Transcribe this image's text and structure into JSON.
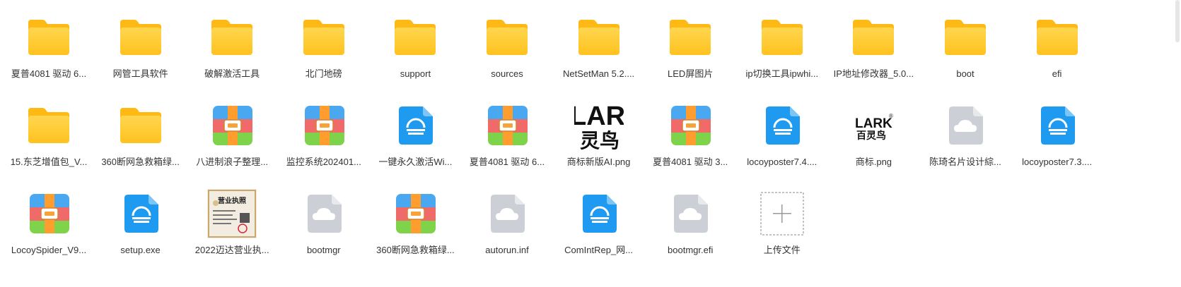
{
  "rows": [
    [
      {
        "name": "夏普4081 驱动 6...",
        "type": "folder"
      },
      {
        "name": "网管工具软件",
        "type": "folder"
      },
      {
        "name": "破解激活工具",
        "type": "folder"
      },
      {
        "name": "北门地磅",
        "type": "folder"
      },
      {
        "name": "support",
        "type": "folder"
      },
      {
        "name": "sources",
        "type": "folder"
      },
      {
        "name": "NetSetMan 5.2....",
        "type": "folder"
      },
      {
        "name": "LED屏图片",
        "type": "folder"
      },
      {
        "name": "ip切换工具ipwhi...",
        "type": "folder"
      },
      {
        "name": "IP地址修改器_5.0...",
        "type": "folder"
      },
      {
        "name": "boot",
        "type": "folder"
      },
      {
        "name": "efi",
        "type": "folder"
      }
    ],
    [
      {
        "name": "15.东芝增值包_V...",
        "type": "folder"
      },
      {
        "name": "360断网急救箱绿...",
        "type": "folder"
      },
      {
        "name": "八进制浪子整理...",
        "type": "archive"
      },
      {
        "name": "监控系统202401...",
        "type": "archive"
      },
      {
        "name": "一键永久激活Wi...",
        "type": "installer"
      },
      {
        "name": "夏普4081 驱动 6...",
        "type": "archive"
      },
      {
        "name": "商标新版AI.png",
        "type": "image-lark-crop"
      },
      {
        "name": "夏普4081 驱动 3...",
        "type": "archive"
      },
      {
        "name": "locoyposter7.4....",
        "type": "installer"
      },
      {
        "name": "商标.png",
        "type": "image-lark"
      },
      {
        "name": "陈琦名片设计綜...",
        "type": "cloud"
      },
      {
        "name": "locoyposter7.3....",
        "type": "installer"
      }
    ],
    [
      {
        "name": "LocoySpider_V9...",
        "type": "archive"
      },
      {
        "name": "setup.exe",
        "type": "installer"
      },
      {
        "name": "2022迈达营业执...",
        "type": "image-license"
      },
      {
        "name": "bootmgr",
        "type": "cloud"
      },
      {
        "name": "360断网急救箱绿...",
        "type": "archive"
      },
      {
        "name": "autorun.inf",
        "type": "cloud"
      },
      {
        "name": "ComIntRep_网...",
        "type": "installer"
      },
      {
        "name": "bootmgr.efi",
        "type": "cloud"
      },
      {
        "name": "上传文件",
        "type": "upload"
      }
    ]
  ],
  "thumbs": {
    "lark_crop_text": "LARK",
    "lark_crop_sub": "灵鸟",
    "lark_text": "LARK",
    "lark_reg": "®",
    "lark_sub": "百灵鸟",
    "license_text": "营业执照"
  }
}
